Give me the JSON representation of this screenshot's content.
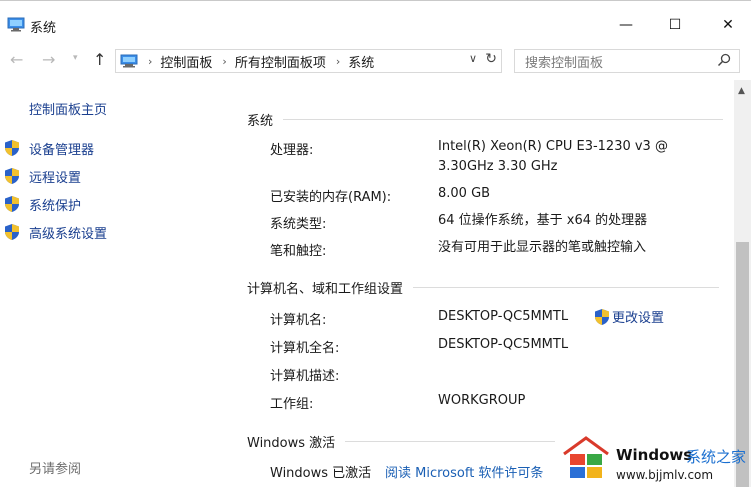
{
  "window": {
    "title": "系统",
    "minimize_glyph": "—",
    "maximize_glyph": "☐",
    "close_glyph": "✕"
  },
  "navbar": {
    "back_glyph": "←",
    "forward_glyph": "→",
    "recent_glyph": "▾",
    "up_glyph": "↑",
    "breadcrumbs": [
      "控制面板",
      "所有控制面板项",
      "系统"
    ],
    "crumb_separator": "›",
    "dropdown_glyph": "∨",
    "refresh_glyph": "↻",
    "search_placeholder": "搜索控制面板"
  },
  "left_pane": {
    "home": "控制面板主页",
    "items": [
      "设备管理器",
      "远程设置",
      "系统保护",
      "高级系统设置"
    ],
    "see_also": "另请参阅"
  },
  "system": {
    "heading": "系统",
    "processor_label": "处理器:",
    "processor_value_line1": "Intel(R) Xeon(R) CPU E3-1230 v3 @",
    "processor_value_line2": "3.30GHz   3.30 GHz",
    "ram_label": "已安装的内存(RAM):",
    "ram_value": "8.00 GB",
    "type_label": "系统类型:",
    "type_value": "64 位操作系统，基于 x64 的处理器",
    "pen_label": "笔和触控:",
    "pen_value": "没有可用于此显示器的笔或触控输入"
  },
  "computer": {
    "heading": "计算机名、域和工作组设置",
    "name_label": "计算机名:",
    "name_value": "DESKTOP-QC5MMTL",
    "change_settings": "更改设置",
    "fullname_label": "计算机全名:",
    "fullname_value": "DESKTOP-QC5MMTL",
    "desc_label": "计算机描述:",
    "workgroup_label": "工作组:",
    "workgroup_value": "WORKGROUP"
  },
  "activation": {
    "heading": "Windows 激活",
    "status": "Windows 已激活",
    "link": "阅读 Microsoft 软件许可条"
  },
  "scrollbar": {
    "up_glyph": "▲"
  },
  "watermark": {
    "brand": "Windows",
    "brand_suffix": "系统之家",
    "url": "www.bjjmlv.com"
  },
  "colors": {
    "link": "#1a3f8f",
    "link_alt": "#1a5fb4",
    "shield_blue": "#2a62c9",
    "shield_yellow": "#f2c12e"
  }
}
